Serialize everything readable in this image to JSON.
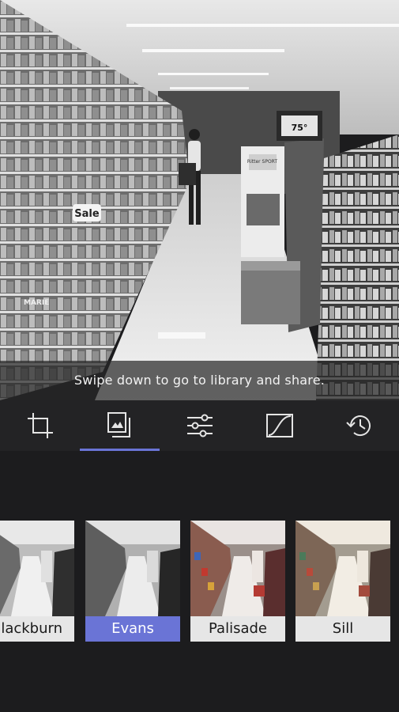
{
  "preview": {
    "hint": "Swipe down to go to library and share.",
    "scene_text": {
      "price": "75°",
      "sale": "Sale",
      "brand": "Ritter SPORT",
      "box": "MARIE"
    }
  },
  "toolbar": {
    "tools": [
      {
        "name": "crop",
        "icon": "crop-icon"
      },
      {
        "name": "filters",
        "icon": "filters-icon",
        "active": true
      },
      {
        "name": "adjust",
        "icon": "sliders-icon"
      },
      {
        "name": "curves",
        "icon": "curves-icon"
      },
      {
        "name": "history",
        "icon": "history-icon"
      }
    ]
  },
  "filters": {
    "items": [
      {
        "label": "Blackburn",
        "style": "bw"
      },
      {
        "label": "Evans",
        "style": "bw",
        "selected": true
      },
      {
        "label": "Palisade",
        "style": "color"
      },
      {
        "label": "Sill",
        "style": "warm"
      }
    ]
  },
  "colors": {
    "accent": "#6a74d6",
    "background": "#1c1c1e",
    "toolbar": "#232325",
    "label_bg": "#e6e6e6"
  }
}
